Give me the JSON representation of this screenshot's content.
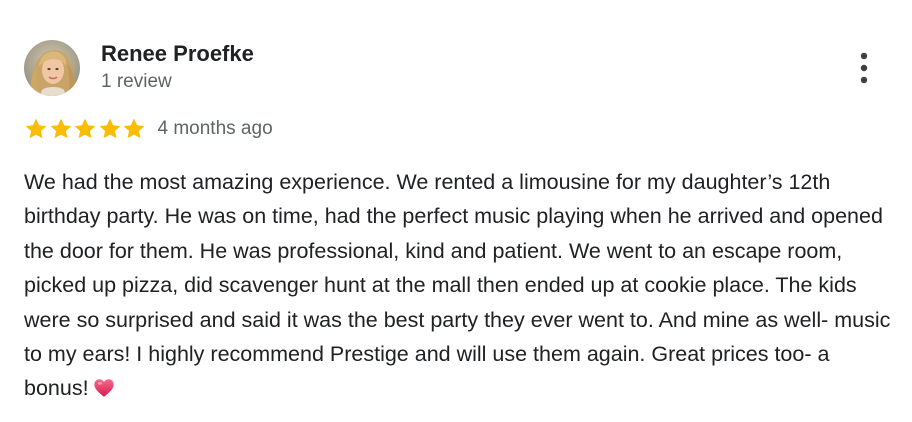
{
  "review": {
    "reviewer_name": "Renee Proefke",
    "review_count": "1 review",
    "rating": 5,
    "rating_max": 5,
    "date": "4 months ago",
    "text": "We had the most amazing experience. We rented a limousine for my daughter’s 12th birthday party. He was on time, had the perfect music playing when he arrived and opened the door for them. He was professional, kind and patient. We went to an escape room, picked up pizza, did scavenger hunt at the mall then ended up at cookie place. The kids were so surprised and said it was the best party they ever went to. And mine as well- music to my ears! I highly recommend Prestige and will use them again. Great prices too- a bonus!",
    "text_end_emoji": "heart-icon"
  },
  "icons": {
    "more_options": "more-vertical-icon",
    "star": "star-icon"
  },
  "colors": {
    "star": "#fbbc04",
    "name": "#202124",
    "secondary_text": "#5f6368",
    "heart": "#e8365d"
  }
}
